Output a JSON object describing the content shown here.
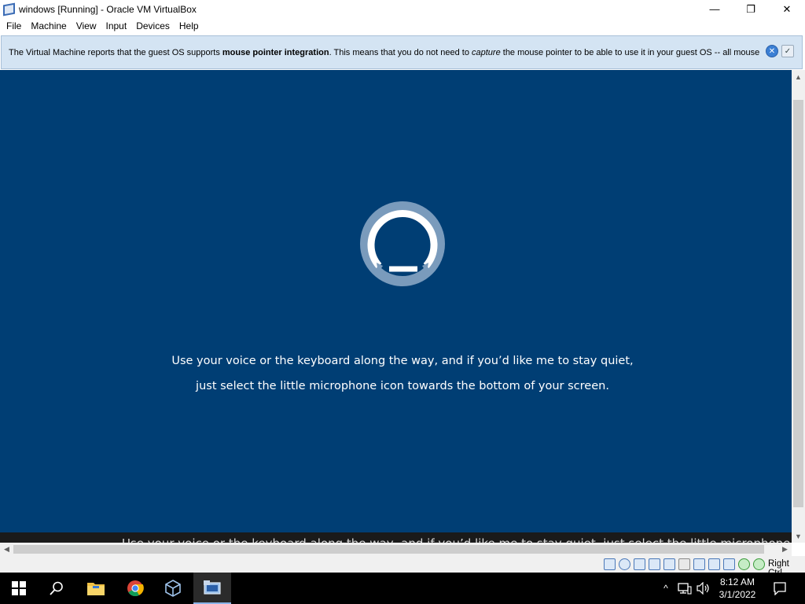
{
  "window": {
    "title": "windows [Running] - Oracle VM VirtualBox",
    "minimize_glyph": "—",
    "maximize_glyph": "❐",
    "close_glyph": "✕"
  },
  "menu": {
    "items": [
      "File",
      "Machine",
      "View",
      "Input",
      "Devices",
      "Help"
    ]
  },
  "notice": {
    "text_before": "The Virtual Machine reports that the guest OS supports ",
    "text_bold": "mouse pointer integration",
    "text_middle": ". This means that you do not need to ",
    "text_italic": "capture",
    "text_after": " the mouse pointer to be able to use it in your guest OS -- all mouse",
    "close_glyph": "✕",
    "mute_glyph": "✓"
  },
  "vm": {
    "caption_line1": "Use your voice or the keyboard along the way, and if you’d like me to stay quiet,",
    "caption_line2": "just select the little microphone icon towards the bottom of your screen.",
    "subtitle_text": "Use your voice or the keyboard along the way, and if you’d like me to stay quiet, just select the little microphone",
    "background_color": "#003e74",
    "spinner_ring_color": "#7a9bbc"
  },
  "scrollbars": {
    "up_glyph": "▲",
    "down_glyph": "▼",
    "left_glyph": "◀",
    "right_glyph": "▶"
  },
  "statusbar": {
    "icons": [
      "hard-disk-icon",
      "optical-drive-icon",
      "audio-icon",
      "network-icon",
      "usb-icon",
      "shared-folders-icon",
      "display-icon",
      "video-capture-icon",
      "vrde-icon",
      "mouse-integration-icon",
      "cpu-icon"
    ],
    "host_key": "Right Ctrl"
  },
  "taskbar": {
    "apps": [
      "start-icon",
      "search-icon",
      "file-explorer-icon",
      "chrome-icon",
      "virtualbox-manager-icon",
      "virtualbox-vm-icon"
    ],
    "time": "8:12 AM",
    "date": "3/1/2022",
    "tray_chevron": "^"
  }
}
